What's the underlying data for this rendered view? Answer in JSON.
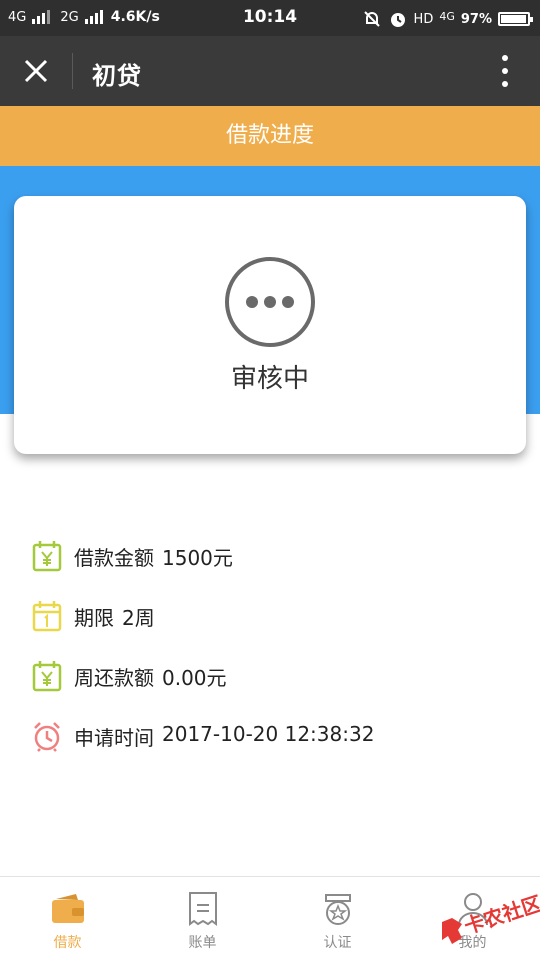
{
  "status_bar": {
    "network_1": "4G",
    "network_2": "2G",
    "speed": "4.6K/s",
    "time": "10:14",
    "hd_label": "HD",
    "lte_label": "4G",
    "battery": "97%",
    "battery_level": 0.97
  },
  "app_bar": {
    "title": "初贷"
  },
  "progress_header": {
    "title": "借款进度"
  },
  "status_card": {
    "status": "审核中"
  },
  "details": [
    {
      "label": "借款金额",
      "value": "1500元",
      "icon": "calendar-yen-icon"
    },
    {
      "label": "期限",
      "value": "2周",
      "icon": "calendar-icon"
    },
    {
      "label": "周还款额",
      "value": "0.00元",
      "icon": "calendar-yen-icon"
    },
    {
      "label": "申请时间",
      "value": "2017-10-20 12:38:32",
      "icon": "alarm-clock-icon"
    }
  ],
  "bottom_nav": [
    {
      "label": "借款",
      "icon": "wallet-icon",
      "active": true
    },
    {
      "label": "账单",
      "icon": "bill-icon",
      "active": false
    },
    {
      "label": "认证",
      "icon": "badge-icon",
      "active": false
    },
    {
      "label": "我的",
      "icon": "user-icon",
      "active": false
    }
  ],
  "watermark": {
    "text": "卡农社区"
  },
  "colors": {
    "accent_orange": "#f0ad4b",
    "header_blue": "#3b9ff0",
    "app_bar": "#3a3a3a",
    "icon_green": "#a4c93b",
    "icon_yellow": "#e8d84a",
    "icon_red": "#f08080"
  }
}
